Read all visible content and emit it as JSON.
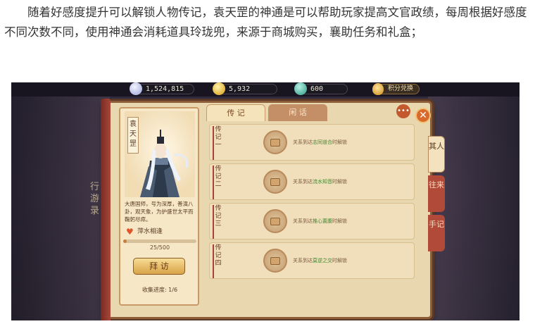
{
  "article": {
    "paragraph": "随着好感度提升可以解锁人物传记，袁天罡的神通是可以帮助玩家提高文官政绩，每周根据好感度不同次数不同，使用神通会消耗道具玲珑兜，来源于商城购买，襄助任务和礼盒；"
  },
  "game": {
    "resources": {
      "pearl": "1,524,815",
      "gold": "5,932",
      "jade": "600"
    },
    "points_exchange_label": "积分兑换",
    "side_text": "行游录",
    "character": {
      "name": "袁天罡",
      "bio": "大唐国师，号为深厚，善演八卦，观天象，为护盛世太平而鞠躬尽瘁。",
      "affinity_label": "萍水相逢",
      "affinity_current": 25,
      "affinity_max": 500,
      "affinity_text": "25/500",
      "visit_button": "拜 访",
      "collection_progress": "收集进度: 1/6"
    },
    "tabs": [
      {
        "label": "传 记",
        "active": true
      },
      {
        "label": "闲 话",
        "active": false
      }
    ],
    "biographies": [
      {
        "label": "传记一",
        "prefix": "关系到达",
        "highlight": "志同道合",
        "suffix": "时解锁"
      },
      {
        "label": "传记二",
        "prefix": "关系到达",
        "highlight": "流水知音",
        "suffix": "时解锁"
      },
      {
        "label": "传记三",
        "prefix": "关系到达",
        "highlight": "推心置腹",
        "suffix": "时解锁"
      },
      {
        "label": "传记四",
        "prefix": "关系到达",
        "highlight": "莫逆之交",
        "suffix": "时解锁"
      }
    ],
    "side_tabs": [
      "其人",
      "往来",
      "手记"
    ],
    "colors": {
      "highlight_green": "#3c8a2e",
      "panel_paper": "#e9d7b0",
      "accent_red": "#b24a3a"
    }
  }
}
